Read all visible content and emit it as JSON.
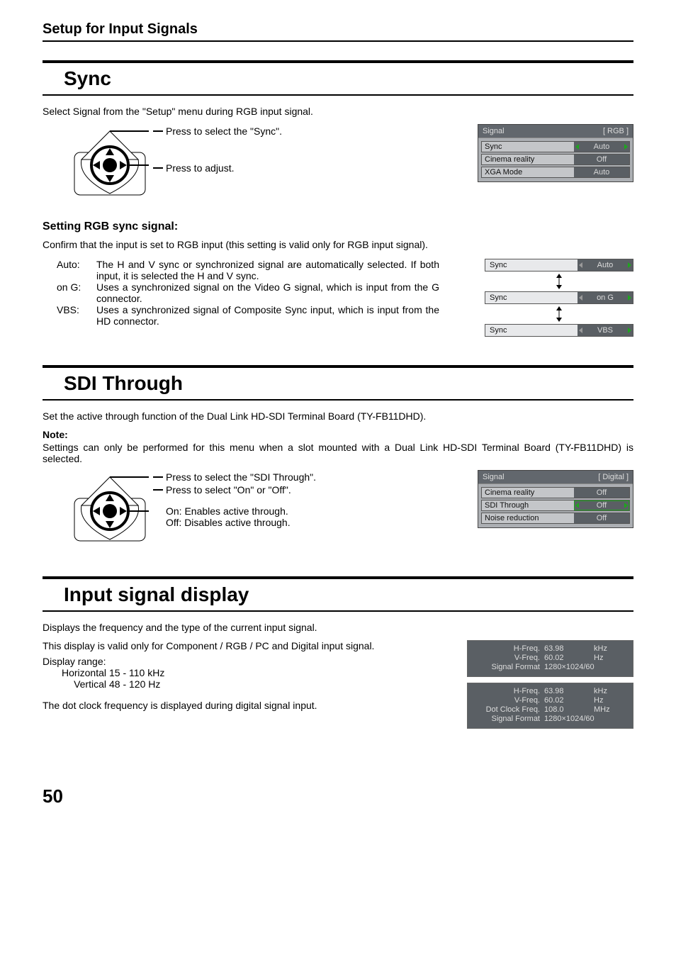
{
  "header": "Setup for Input Signals",
  "page_number": "50",
  "sync": {
    "title": "Sync",
    "intro": "Select Signal from the \"Setup\" menu during RGB input signal.",
    "press1": "Press to select the \"Sync\".",
    "press2": "Press to adjust.",
    "menu_title": "Signal",
    "menu_mode": "[ RGB ]",
    "rows": [
      {
        "label": "Sync",
        "value": "Auto",
        "arrows": "green"
      },
      {
        "label": "Cinema reality",
        "value": "Off",
        "arrows": "none"
      },
      {
        "label": "XGA Mode",
        "value": "Auto",
        "arrows": "none"
      }
    ],
    "setting_heading": "Setting RGB sync signal:",
    "confirm": "Confirm that the input is set to RGB input (this setting is valid only for RGB input signal).",
    "defs": [
      {
        "label": "Auto:",
        "text": "The H and V sync or synchronized signal are automatically selected. If both input, it is selected the H and V sync."
      },
      {
        "label": "on G:",
        "text": "Uses a synchronized signal on the Video G signal, which is input from the G connector."
      },
      {
        "label": "VBS:",
        "text": "Uses a synchronized signal of Composite Sync input, which is input from the HD connector."
      }
    ],
    "options": [
      {
        "label": "Sync",
        "value": "Auto"
      },
      {
        "label": "Sync",
        "value": "on G"
      },
      {
        "label": "Sync",
        "value": "VBS"
      }
    ]
  },
  "sdi": {
    "title": "SDI Through",
    "intro": "Set the active through function of the Dual Link HD-SDI Terminal Board (TY-FB11DHD).",
    "note_label": "Note:",
    "note_body": "Settings can only be performed for this menu when a slot mounted with a Dual Link HD-SDI Terminal Board (TY-FB11DHD) is selected.",
    "press1": "Press to select the \"SDI Through\".",
    "press2": "Press to select \"On\" or \"Off\".",
    "on_text": "On: Enables active through.",
    "off_text": "Off: Disables active through.",
    "menu_title": "Signal",
    "menu_mode": "[ Digital ]",
    "rows": [
      {
        "label": "Cinema reality",
        "value": "Off",
        "arrows": "none"
      },
      {
        "label": "SDI Through",
        "value": "Off",
        "arrows": "green",
        "highlight": true
      },
      {
        "label": "Noise reduction",
        "value": "Off",
        "arrows": "none"
      }
    ]
  },
  "isd": {
    "title": "Input signal display",
    "intro": "Displays the frequency and the type of the current input signal.",
    "valid": "This display is valid only for Component / RGB / PC and Digital input signal.",
    "range_label": "Display range:",
    "range_rows": [
      {
        "label": "Horizontal",
        "value": "15 - 110 kHz"
      },
      {
        "label": "Vertical",
        "value": "48 - 120 Hz"
      }
    ],
    "dotclock": "The dot clock frequency is displayed during digital signal input.",
    "panel1": [
      {
        "label": "H-Freq.",
        "value": "63.98",
        "unit": "kHz"
      },
      {
        "label": "V-Freq.",
        "value": "60.02",
        "unit": "Hz"
      },
      {
        "label": "Signal Format",
        "value": "1280×1024/60",
        "unit": ""
      }
    ],
    "panel2": [
      {
        "label": "H-Freq.",
        "value": "63.98",
        "unit": "kHz"
      },
      {
        "label": "V-Freq.",
        "value": "60.02",
        "unit": "Hz"
      },
      {
        "label": "Dot Clock Freq.",
        "value": "108.0",
        "unit": "MHz"
      },
      {
        "label": "Signal Format",
        "value": "1280×1024/60",
        "unit": ""
      }
    ]
  }
}
